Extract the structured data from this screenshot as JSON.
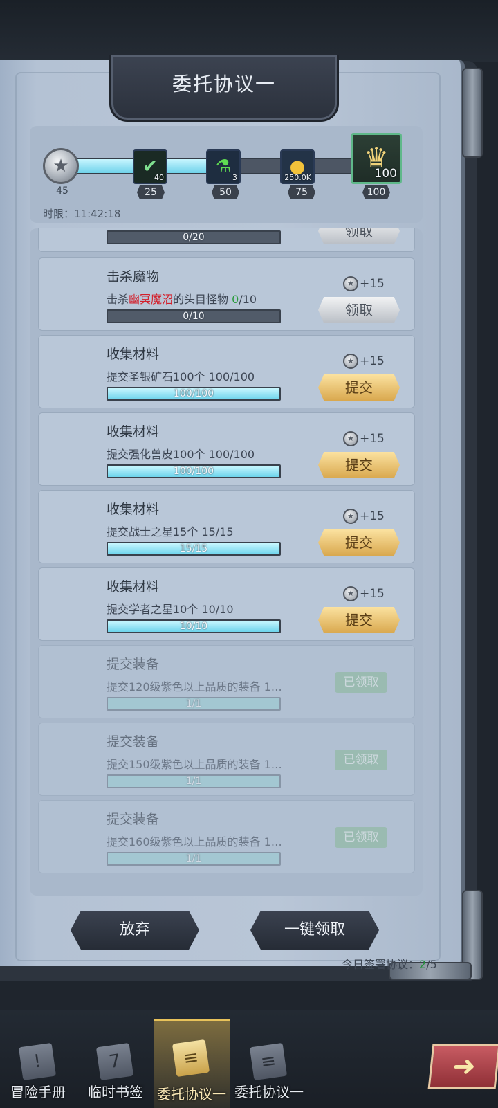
{
  "title": "委托协议一",
  "progress": {
    "current_points": "45",
    "fill_fraction": 0.47,
    "rewards": [
      {
        "icon": "check-scroll-icon",
        "qty": "40",
        "milestone": "25"
      },
      {
        "icon": "potion-icon",
        "qty": "3",
        "milestone": "50"
      },
      {
        "icon": "gold-coin-icon",
        "qty": "250.0K",
        "milestone": "75"
      },
      {
        "icon": "crown-icon",
        "qty": "100",
        "milestone": "100"
      }
    ],
    "time_limit": "时限：11:42:18"
  },
  "tasks": [
    {
      "title": "",
      "desc": "",
      "bar": "0/20",
      "fill": 0,
      "points": "",
      "button": "领取",
      "state": "claim"
    },
    {
      "title": "击杀魔物",
      "desc_pre": "击杀",
      "desc_red": "幽冥魔沼",
      "desc_mid": "的头目怪物 ",
      "desc_green": "0",
      "desc_post": "/10",
      "bar": "0/10",
      "fill": 0,
      "points": "+15",
      "button": "领取",
      "state": "claim"
    },
    {
      "title": "收集材料",
      "desc": "提交圣银矿石100个 100/100",
      "bar": "100/100",
      "fill": 1,
      "points": "+15",
      "button": "提交",
      "state": "submit"
    },
    {
      "title": "收集材料",
      "desc": "提交强化兽皮100个 100/100",
      "bar": "100/100",
      "fill": 1,
      "points": "+15",
      "button": "提交",
      "state": "submit"
    },
    {
      "title": "收集材料",
      "desc": "提交战士之星15个 15/15",
      "bar": "15/15",
      "fill": 1,
      "points": "+15",
      "button": "提交",
      "state": "submit"
    },
    {
      "title": "收集材料",
      "desc": "提交学者之星10个 10/10",
      "bar": "10/10",
      "fill": 1,
      "points": "+15",
      "button": "提交",
      "state": "submit"
    },
    {
      "title": "提交装备",
      "desc": "提交120级紫色以上品质的装备 1…",
      "bar": "1/1",
      "fill": 1,
      "points": "",
      "button": "已领取",
      "state": "claimed"
    },
    {
      "title": "提交装备",
      "desc": "提交150级紫色以上品质的装备 1…",
      "bar": "1/1",
      "fill": 1,
      "points": "",
      "button": "已领取",
      "state": "claimed"
    },
    {
      "title": "提交装备",
      "desc": "提交160级紫色以上品质的装备 1…",
      "bar": "1/1",
      "fill": 1,
      "points": "",
      "button": "已领取",
      "state": "claimed"
    }
  ],
  "actions": {
    "abandon": "放弃",
    "claim_all": "一键领取"
  },
  "sign": {
    "label": "今日签署协议：",
    "current": "2",
    "total": "/5"
  },
  "nav": [
    {
      "label": "冒险手册",
      "icon": "exclamation-book-icon"
    },
    {
      "label": "临时书签",
      "icon": "calendar-7-icon"
    },
    {
      "label": "委托协议一",
      "icon": "documents-icon",
      "active": true
    },
    {
      "label": "委托协议一",
      "icon": "documents-icon"
    }
  ],
  "next_icon": "arrow-right-icon"
}
